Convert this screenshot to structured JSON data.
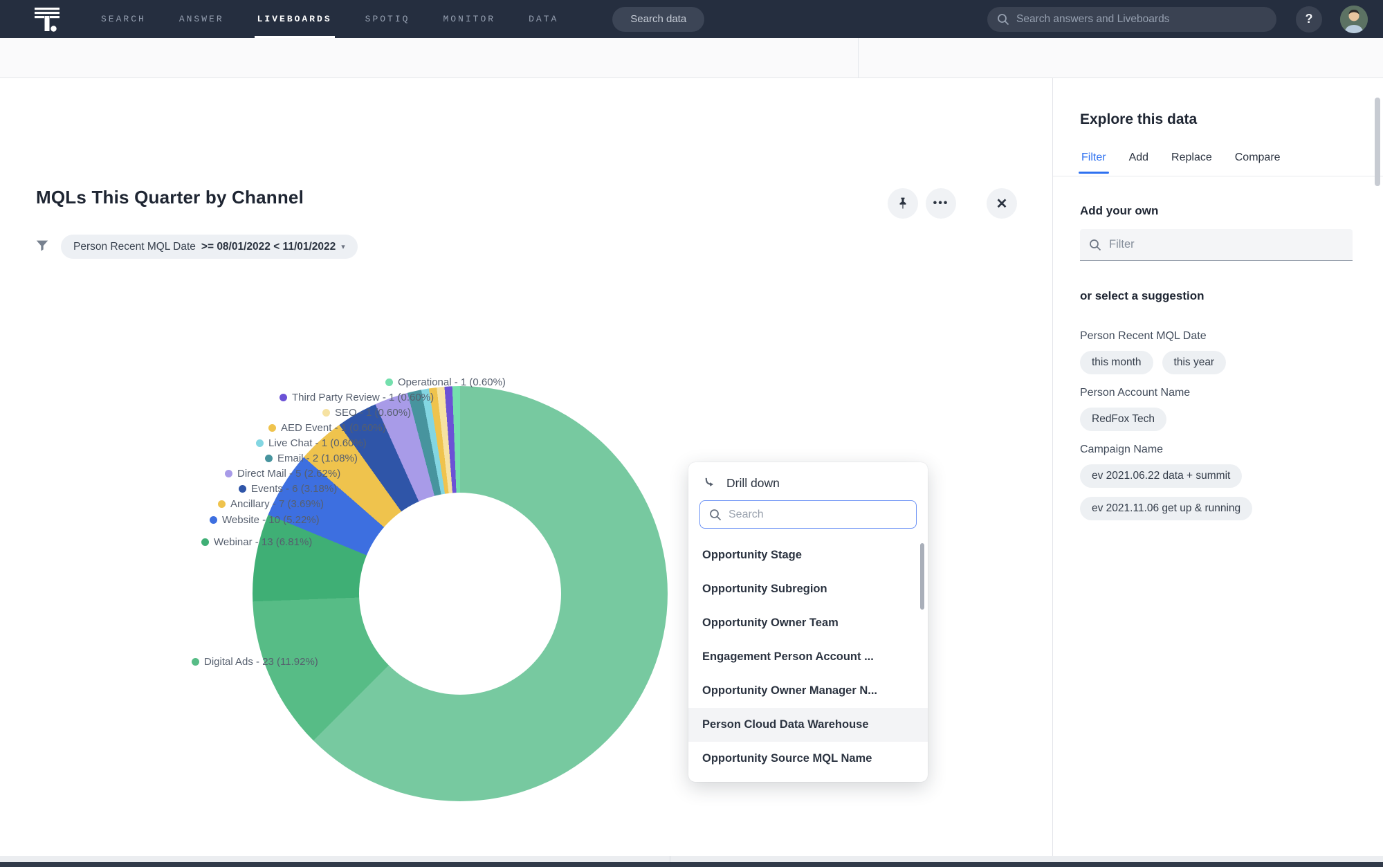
{
  "nav": {
    "items": [
      {
        "label": "SEARCH",
        "active": false
      },
      {
        "label": "ANSWER",
        "active": false
      },
      {
        "label": "LIVEBOARDS",
        "active": true
      },
      {
        "label": "SPOTIQ",
        "active": false
      },
      {
        "label": "MONITOR",
        "active": false
      },
      {
        "label": "DATA",
        "active": false
      }
    ],
    "search_data_button": "Search data",
    "global_search_placeholder": "Search answers and Liveboards",
    "help_label": "?"
  },
  "viz": {
    "title": "MQLs This Quarter by Channel",
    "filter_chip": {
      "field": "Person Recent MQL Date",
      "condition": ">= 08/01/2022 < 11/01/2022"
    }
  },
  "chart_data": {
    "type": "pie",
    "donut": true,
    "title": "MQLs This Quarter by Channel",
    "legend_position": "outside-left-labels",
    "slices": [
      {
        "label": "",
        "value": null,
        "pct": "62.48",
        "color": "#77C9A0",
        "note": "large remainder slice, label hidden behind drill-down menu"
      },
      {
        "label": "Digital Ads",
        "value": 23,
        "pct": "11.92",
        "color": "#57BC86"
      },
      {
        "label": "Webinar",
        "value": 13,
        "pct": "6.81",
        "color": "#3FAF75"
      },
      {
        "label": "Website",
        "value": 10,
        "pct": "5.22",
        "color": "#3D6FE0"
      },
      {
        "label": "Ancillary",
        "value": 7,
        "pct": "3.69",
        "color": "#EFC34D"
      },
      {
        "label": "Events",
        "value": 6,
        "pct": "3.18",
        "color": "#2F55A8"
      },
      {
        "label": "Direct Mail",
        "value": 5,
        "pct": "2.62",
        "color": "#A89BE8"
      },
      {
        "label": "Email",
        "value": 2,
        "pct": "1.08",
        "color": "#47949E"
      },
      {
        "label": "Live Chat",
        "value": 1,
        "pct": "0.60",
        "color": "#83D6E2"
      },
      {
        "label": "AED Event",
        "value": 1,
        "pct": "0.60",
        "color": "#EFC34D"
      },
      {
        "label": "SEO",
        "value": 1,
        "pct": "0.60",
        "color": "#F6E2A2"
      },
      {
        "label": "Third Party Review",
        "value": 1,
        "pct": "0.60",
        "color": "#6B52D6"
      },
      {
        "label": "Operational",
        "value": 1,
        "pct": "0.60",
        "color": "#74DFAD"
      }
    ]
  },
  "drilldown": {
    "title": "Drill down",
    "search_placeholder": "Search",
    "items": [
      "Opportunity Stage",
      "Opportunity Subregion",
      "Opportunity Owner Team",
      "Engagement Person Account ...",
      "Opportunity Owner Manager N...",
      "Person Cloud Data Warehouse",
      "Opportunity Source MQL Name"
    ],
    "highlighted": "Person Cloud Data Warehouse"
  },
  "explore": {
    "title": "Explore this data",
    "tabs": [
      {
        "label": "Filter",
        "active": true
      },
      {
        "label": "Add",
        "active": false
      },
      {
        "label": "Replace",
        "active": false
      },
      {
        "label": "Compare",
        "active": false
      }
    ],
    "add_your_own": "Add your own",
    "filter_placeholder": "Filter",
    "suggestion_heading": "or select a suggestion",
    "groups": [
      {
        "name": "Person Recent MQL Date",
        "chips": [
          "this month",
          "this year"
        ]
      },
      {
        "name": "Person Account Name",
        "chips": [
          "RedFox Tech"
        ]
      },
      {
        "name": "Campaign Name",
        "chips": [
          "ev 2021.06.22 data + summit",
          "ev 2021.11.06 get up & running"
        ]
      }
    ]
  }
}
